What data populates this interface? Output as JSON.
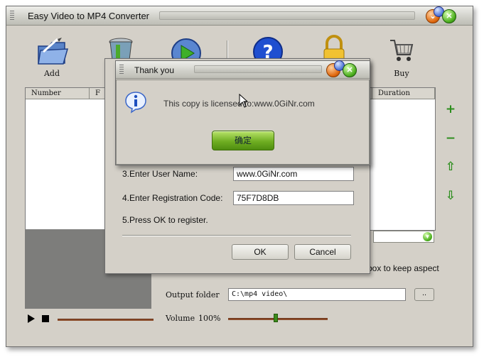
{
  "main_window": {
    "title": "Easy Video to MP4 Converter",
    "toolbar": {
      "add_label": "Add",
      "buy_label": "Buy"
    },
    "file_list": {
      "columns": [
        "Number",
        "F",
        "Duration"
      ]
    },
    "side_buttons": {
      "add": "+",
      "remove": "−",
      "up": "⇧",
      "down": "⇩"
    },
    "aspect_text": "box to keep aspect",
    "output_folder_label": "Output folder",
    "output_folder_value": "C:\\mp4 video\\",
    "browse_label": "..",
    "volume_label": "Volume",
    "volume_value": "100%"
  },
  "registration_dialog": {
    "user_name_label": "3.Enter User Name:",
    "user_name_value": "www.0GiNr.com",
    "reg_code_label": "4.Enter Registration Code:",
    "reg_code_value": "75F7D8DB",
    "instruction": "5.Press OK to register.",
    "ok_label": "OK",
    "cancel_label": "Cancel"
  },
  "thanks_dialog": {
    "title": "Thank you",
    "message": "This copy is licensed to:www.0GiNr.com",
    "ok_label": "确定"
  },
  "colors": {
    "window_bg": "#d4d0c8",
    "accent_green": "#4eb020",
    "preview_bg": "#7d7d7b"
  }
}
